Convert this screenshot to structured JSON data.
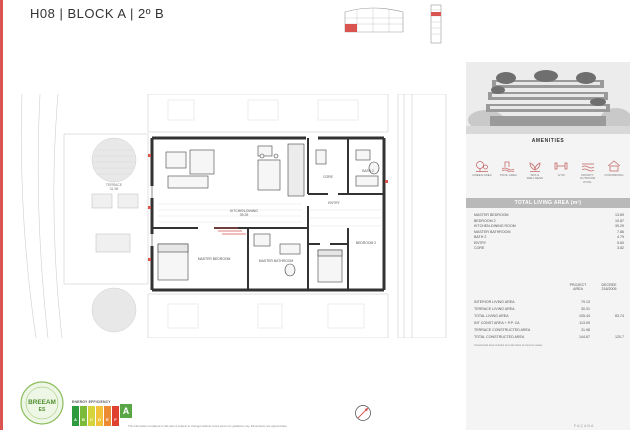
{
  "header": {
    "title": "H08  |  BLOCK A  |  2º B"
  },
  "plan": {
    "terrace_label": "TERRACE",
    "terrace_area": "31.98",
    "kitchen_label": "KITCHEN-DINING",
    "kitchen_area": "39.29",
    "core_label": "CORE",
    "bath2_label": "BATH 2",
    "entry_label": "ENTRY",
    "bedroom2_label": "BEDROOM 2",
    "master_bedroom_label": "MASTER BEDROOM",
    "master_bath_label": "MASTER BATHROOM"
  },
  "amenities": {
    "title": "AMENITIES",
    "items": [
      {
        "label": "GREEN AREA",
        "icon": "tree-icon"
      },
      {
        "label": "POOL AREA",
        "icon": "pool-icon"
      },
      {
        "label": "SPA & WELLNESS",
        "icon": "spa-icon"
      },
      {
        "label": "GYM",
        "icon": "gym-icon"
      },
      {
        "label": "INFINITY OUTDOOR POOL",
        "icon": "infinity-pool-icon"
      },
      {
        "label": "COWORKING",
        "icon": "coworking-icon"
      }
    ]
  },
  "total_living_area": {
    "title": "TOTAL LIVING AREA (m²)",
    "rooms": [
      {
        "name": "MASTER BEDROOM",
        "area": "13.89"
      },
      {
        "name": "BEDROOM 2",
        "area": "10.87"
      },
      {
        "name": "KITCHEN-DINING ROOM",
        "area": "39.29"
      },
      {
        "name": "MASTER BATHROOM",
        "area": "7.86"
      },
      {
        "name": "BATH 2",
        "area": "4.79"
      },
      {
        "name": "ENTRY",
        "area": "5.60"
      },
      {
        "name": "CORE",
        "area": "3.82"
      }
    ]
  },
  "constructed": {
    "col1": "PROJECT AREA",
    "col2": "DECREE 218/2005",
    "rows": [
      {
        "label": "INTERIOR LIVING AREA",
        "project": "79.13",
        "decree": ""
      },
      {
        "label": "TERRACE LIVING AREA",
        "project": "30.31",
        "decree": ""
      },
      {
        "label": "TOTAL LIVING AREA",
        "project": "105.44",
        "decree": "83.74"
      },
      {
        "label": "INT CONST AREA + P.P. CA",
        "project": "113.09",
        "decree": ""
      },
      {
        "label": "TERRACE CONSTRUCTED AREA",
        "project": "31.98",
        "decree": ""
      },
      {
        "label": "TOTAL CONSTRUCTED AREA",
        "project": "144.67",
        "decree": "120.7"
      }
    ],
    "footnote": "Constructed area includes pro-rata share of common areas."
  },
  "certs": {
    "breeam_line1": "BREEAM",
    "breeam_line2": "ES",
    "energy_label": "ENERGY EFFICIENCY",
    "energy_grade": "A",
    "bar_letters": [
      "A",
      "B",
      "C",
      "D",
      "E",
      "F"
    ]
  },
  "footer": {
    "disclaimer": "The information contained in this plan is subject to changes without notice and is for guidance only. Dimensions are approximate.",
    "logo": "FAÇANA"
  },
  "colors": {
    "accent": "#d9534f",
    "wall": "#333333",
    "panel": "#f4f4f4",
    "bar": "#b9b9b9"
  }
}
